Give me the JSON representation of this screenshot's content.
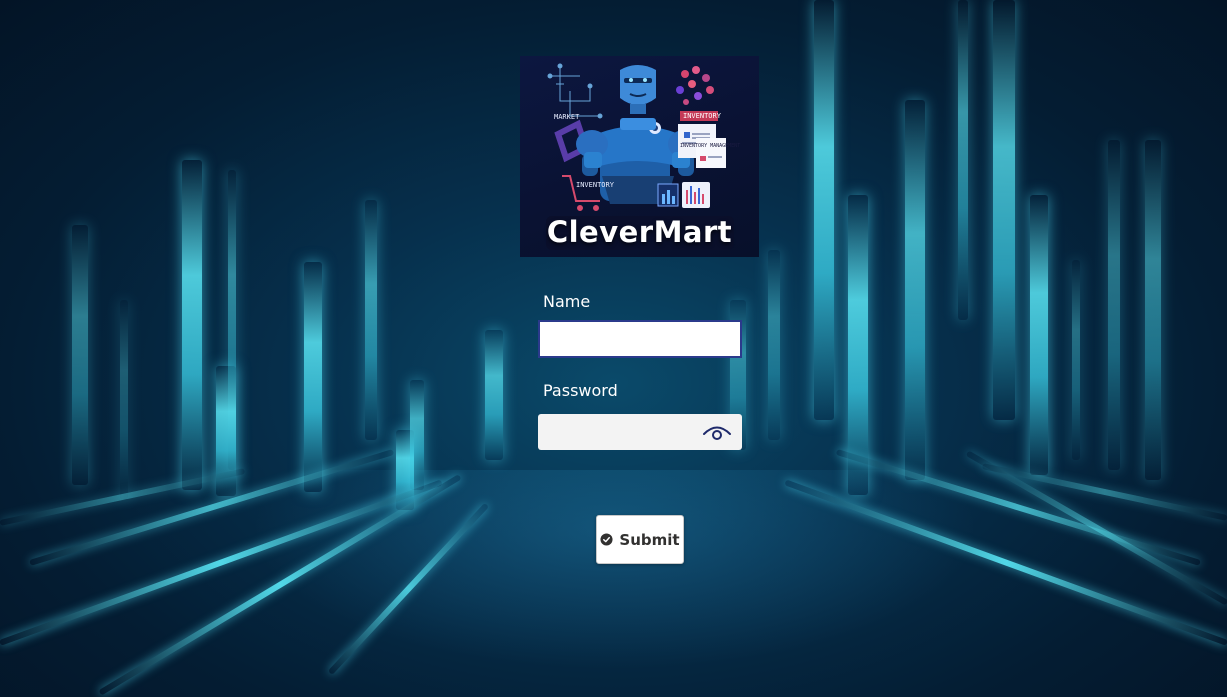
{
  "logo": {
    "title": "CleverMart",
    "tags": {
      "market": "MARKET",
      "inventory_top": "INVENTORY",
      "inventory_doc": "INVENTORY MANAGEMENT",
      "inventory_bottom": "INVENTORY"
    }
  },
  "form": {
    "name_label": "Name",
    "name_value": "",
    "password_label": "Password",
    "password_value": "",
    "submit_label": "Submit"
  },
  "colors": {
    "input_border": "#2b3a8c",
    "password_bg": "#f3f3f3",
    "eye_icon": "#1f2a6b",
    "beam": "#5ae6f5"
  }
}
